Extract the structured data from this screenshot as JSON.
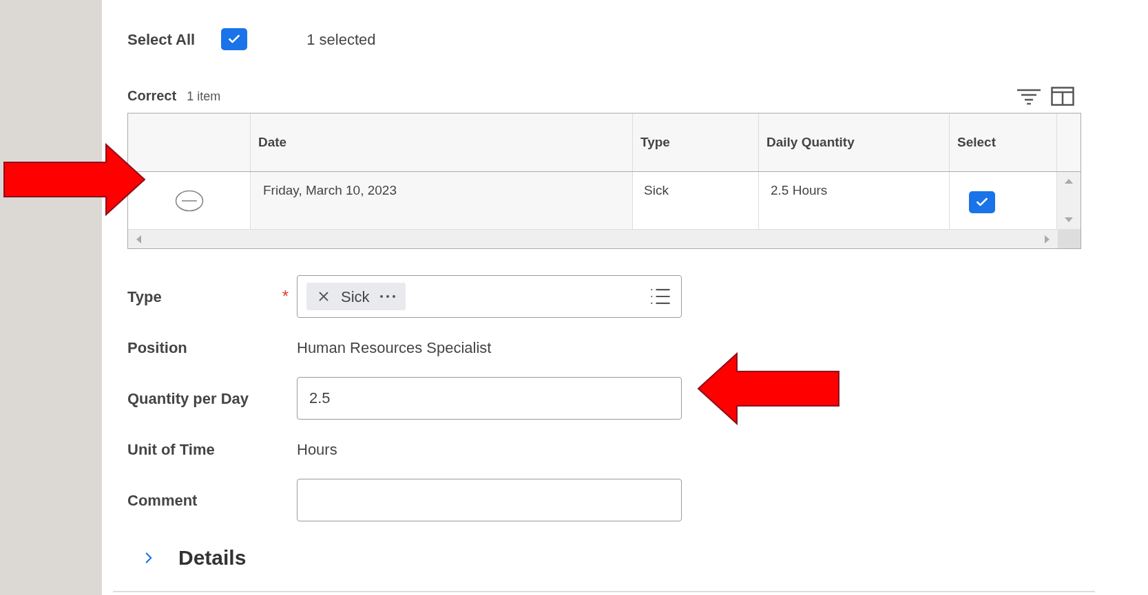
{
  "select_all": {
    "label": "Select All",
    "checked": true,
    "count": "1 selected"
  },
  "table": {
    "title": "Correct",
    "count": "1 item",
    "columns": [
      "Date",
      "Type",
      "Daily Quantity",
      "Select"
    ],
    "rows": [
      {
        "date": "Friday, March 10, 2023",
        "type": "Sick",
        "daily_quantity": "2.5 Hours",
        "selected": true
      }
    ]
  },
  "form": [
    {
      "kind": "chip",
      "label": "Type",
      "required_mark": "*",
      "chip": "Sick"
    },
    {
      "kind": "text",
      "label": "Position",
      "value": "Human Resources Specialist"
    },
    {
      "kind": "input",
      "label": "Quantity per Day",
      "value": "2.5"
    },
    {
      "kind": "text",
      "label": "Unit of Time",
      "value": "Hours"
    },
    {
      "kind": "input",
      "label": "Comment"
    }
  ],
  "details": {
    "label": "Details",
    "expanded": false
  }
}
